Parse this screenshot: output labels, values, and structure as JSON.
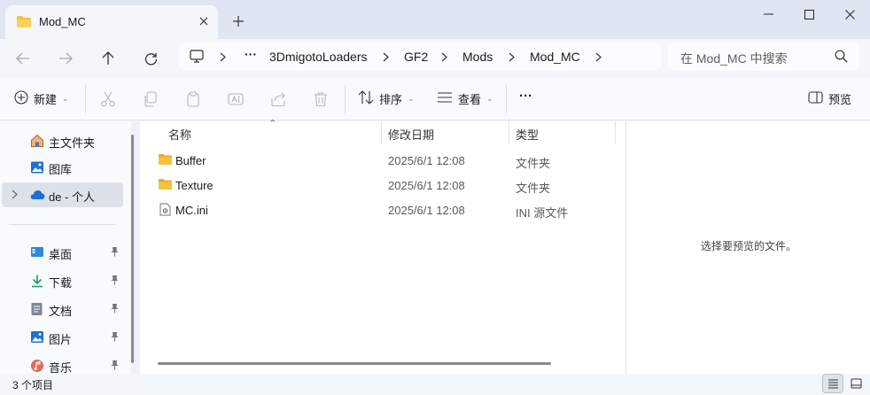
{
  "window": {
    "tab_title": "Mod_MC",
    "new_tab_label": "+"
  },
  "address_bar": {
    "breadcrumbs": [
      "3DmigotoLoaders",
      "GF2",
      "Mods",
      "Mod_MC"
    ],
    "overflow": "···"
  },
  "search": {
    "placeholder": "在 Mod_MC 中搜索"
  },
  "toolbar": {
    "new_label": "新建",
    "sort_label": "排序",
    "view_label": "查看",
    "more_label": "···",
    "preview_label": "预览"
  },
  "sidebar": {
    "top_items": [
      {
        "label": "主文件夹",
        "icon": "home-icon"
      },
      {
        "label": "图库",
        "icon": "gallery-icon"
      },
      {
        "label": "de - 个人",
        "icon": "onedrive-cloud-icon"
      }
    ],
    "quick_items": [
      {
        "label": "桌面",
        "icon": "desktop-icon"
      },
      {
        "label": "下载",
        "icon": "download-icon"
      },
      {
        "label": "文档",
        "icon": "documents-icon"
      },
      {
        "label": "图片",
        "icon": "pictures-icon"
      },
      {
        "label": "音乐",
        "icon": "music-icon"
      }
    ]
  },
  "file_list": {
    "columns": [
      "名称",
      "修改日期",
      "类型"
    ],
    "rows": [
      {
        "name": "Buffer",
        "date": "2025/6/1 12:08",
        "type": "文件夹",
        "icon": "folder-icon"
      },
      {
        "name": "Texture",
        "date": "2025/6/1 12:08",
        "type": "文件夹",
        "icon": "folder-icon"
      },
      {
        "name": "MC.ini",
        "date": "2025/6/1 12:08",
        "type": "INI 源文件",
        "icon": "ini-file-icon"
      }
    ]
  },
  "preview_pane": {
    "message": "选择要预览的文件。"
  },
  "status_bar": {
    "item_count": "3 个项目"
  },
  "colors": {
    "folder": "#f5c342",
    "accent": "#0067c0",
    "titlebar": "#dfe6f1"
  }
}
